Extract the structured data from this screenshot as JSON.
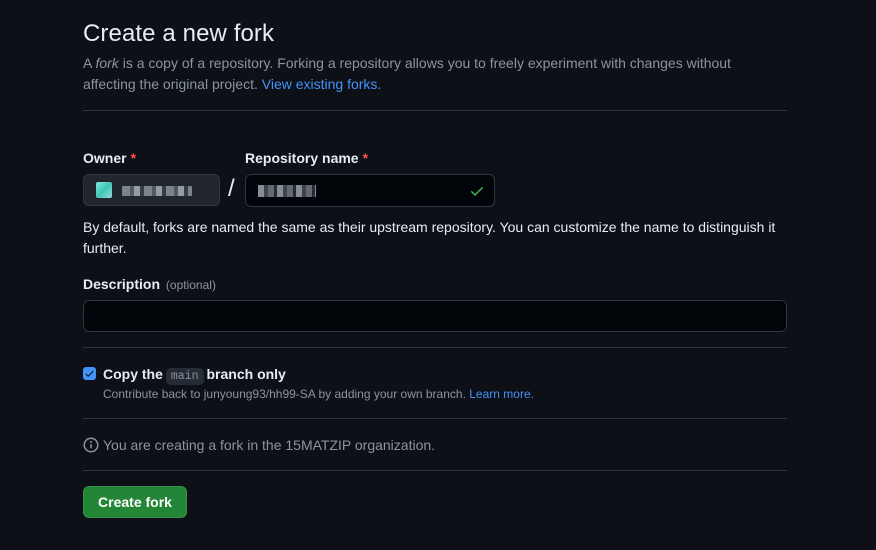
{
  "page": {
    "title": "Create a new fork",
    "intro_prefix": "A ",
    "intro_em": "fork",
    "intro_suffix": " is a copy of a repository. Forking a repository allows you to freely experiment with changes without affecting the original project. ",
    "intro_link": "View existing forks."
  },
  "form": {
    "owner_label": "Owner",
    "repo_label": "Repository name",
    "required_mark": "*",
    "slash": "/",
    "help_text": "By default, forks are named the same as their upstream repository. You can customize the name to distinguish it further.",
    "description_label": "Description",
    "description_optional": "(optional)",
    "description_placeholder": "",
    "copy_label_before": "Copy the",
    "copy_branch": "main",
    "copy_label_after": "branch only",
    "copy_checked": true,
    "copy_note": "Contribute back to junyoung93/hh99-SA by adding your own branch. ",
    "copy_note_link": "Learn more.",
    "info_text": "You are creating a fork in the 15MATZIP organization.",
    "submit_label": "Create fork"
  },
  "colors": {
    "background": "#0d1117",
    "accent_link": "#4493f8",
    "success": "#3fb950",
    "button": "#238636",
    "required": "#f85149"
  },
  "icons": {
    "repo_valid": "check-icon",
    "checkbox": "checkmark-icon",
    "info": "info-icon"
  }
}
